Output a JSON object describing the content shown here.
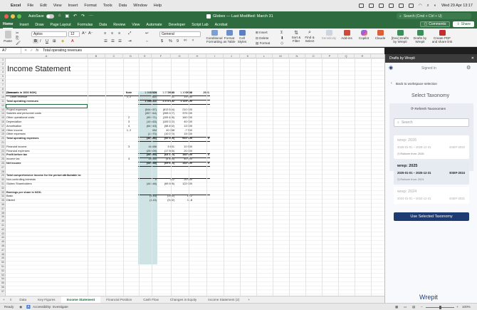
{
  "menubar": {
    "apple": "",
    "app": "Excel",
    "items": [
      "File",
      "Edit",
      "View",
      "Insert",
      "Format",
      "Tools",
      "Data",
      "Window",
      "Help"
    ],
    "datetime": "Wed 29 Apr 13:17"
  },
  "titlebar": {
    "autosave": "AutoSave",
    "doc_title": "Globex — Last Modified: March 31",
    "search_placeholder": "Search (Cmd + Ctrl + U)"
  },
  "ribbon_tabs": [
    "Home",
    "Insert",
    "Draw",
    "Page Layout",
    "Formulas",
    "Data",
    "Review",
    "View",
    "Automate",
    "Developer",
    "Script Lab",
    "Acrobat"
  ],
  "comments_label": "Comments",
  "share_label": "Share",
  "ribbon": {
    "paste": "Paste",
    "font": "Aptos",
    "font_size": "12",
    "number_format": "General",
    "insert": "Insert",
    "delete": "Delete",
    "format": "Format",
    "cond_format": "Conditional Formatting",
    "format_table": "Format as Table",
    "cell_styles": "Cell Styles",
    "sort_filter": "Sort & Filter",
    "find_select": "Find & Select",
    "sensitivity": "Sensitivity",
    "addins": "Add-ins",
    "copilot": "Copilot",
    "claude": "Claude",
    "drafts": "[Dev] Drafts by Wrepit",
    "drafts2": "Drafts by Wrepit",
    "create_pdf": "Create PDF and share link"
  },
  "formula": {
    "cell_ref": "A7",
    "fx": "fx",
    "value": "Total operating revenues"
  },
  "columns": [
    "A",
    "B",
    "C",
    "D",
    "E",
    "F",
    "G",
    "H",
    "I",
    "J",
    "K",
    "L",
    "M",
    "N",
    "O",
    "P",
    "Q",
    "R"
  ],
  "rows": [
    "1",
    "2",
    "3",
    "4",
    "5",
    "6",
    "7",
    "8",
    "9",
    "10",
    "11",
    "12",
    "13",
    "14",
    "15",
    "16",
    "17",
    "18",
    "19",
    "20",
    "21",
    "22",
    "23",
    "24",
    "25",
    "26",
    "27",
    "28",
    "29",
    "30",
    "31",
    "32",
    "33",
    "34",
    "35",
    "36",
    "37",
    "38",
    "39",
    "40",
    "41",
    "42",
    "43",
    "44",
    "45",
    "46",
    "47",
    "48",
    "49",
    "50",
    "51",
    "52",
    "53",
    "54",
    "55",
    "56",
    "57"
  ],
  "sheet": {
    "title": "Income Statement",
    "header": {
      "label": "(Amounts in 1000 NOK)",
      "note": "Note",
      "y2024": "2024",
      "y2023": "2023",
      "y2022": "2022",
      "y2021": "2021"
    },
    "lines": [
      {
        "label": "Revenue",
        "note": "",
        "a": "1 088 870",
        "b": "1 273 641",
        "c": "1 100 000",
        "d": ""
      },
      {
        "label": "Other revenue",
        "note": "1, 2",
        "a": "521",
        "b": "11",
        "c": "19 000",
        "d": ""
      },
      {
        "label": "Total operating revenues",
        "note": "",
        "a": "1 089 411",
        "b": "1 273 652",
        "c": "1 119 000",
        "d": ""
      },
      {
        "label": "",
        "note": "",
        "a": "",
        "b": "",
        "c": "",
        "d": ""
      },
      {
        "label": "Project expenses",
        "note": "",
        "a": "(544 657)",
        "b": "(813 534)",
        "c": "210 000",
        "d": ""
      },
      {
        "label": "Salaries and personnel costs",
        "note": "",
        "a": "(357 964)",
        "b": "(265 027)",
        "c": "375 000",
        "d": ""
      },
      {
        "label": "Other operational costs",
        "note": "2",
        "a": "(99 571)",
        "b": "(109 426)",
        "c": "160 000",
        "d": ""
      },
      {
        "label": "Depreciation",
        "note": "3",
        "a": "(10 663)",
        "b": "(109 222)",
        "c": "40 000",
        "d": ""
      },
      {
        "label": "Amortisation",
        "note": "4",
        "a": "(64 915)",
        "b": "(58 492)",
        "c": "13 000",
        "d": ""
      },
      {
        "label": "Other income",
        "note": "1, 2",
        "a": "494",
        "b": "40 058",
        "c": "-7 500",
        "d": ""
      },
      {
        "label": "Other expenses",
        "note": "",
        "a": "(1 970)",
        "b": "(10 070)",
        "c": "15 000",
        "d": ""
      },
      {
        "label": "Total operating expenses",
        "note": "",
        "a": "(30 486)",
        "b": "(52 205)",
        "c": "921 500",
        "d": "0"
      },
      {
        "label": "",
        "note": "",
        "a": "",
        "b": "",
        "c": "",
        "d": ""
      },
      {
        "label": "Financial income",
        "note": "3",
        "a": "16 456",
        "b": "5 601",
        "c": "10 500",
        "d": ""
      },
      {
        "label": "Financial expenses",
        "note": "",
        "a": "(25 509)",
        "b": "(17 565)",
        "c": "20 000",
        "d": ""
      },
      {
        "label": "Profit before tax",
        "note": "",
        "a": "(59 550)",
        "b": "(64 170)",
        "c": "182 000",
        "d": "0"
      },
      {
        "label": "Income tax",
        "note": "3",
        "a": "15 000",
        "b": "(4 445)",
        "c": "40 000",
        "d": ""
      },
      {
        "label": "Net income",
        "note": "",
        "a": "(44 548)",
        "b": "(69 614)",
        "c": "142 000",
        "d": "0"
      },
      {
        "label": "",
        "note": "",
        "a": "",
        "b": "",
        "c": "",
        "d": ""
      },
      {
        "label": "",
        "note": "",
        "a": "",
        "b": "",
        "c": "",
        "d": ""
      },
      {
        "label": "Total comprehensive income for the period attributable to:",
        "note": "",
        "a": "",
        "b": "",
        "c": "",
        "d": ""
      },
      {
        "label": "Non-controlling interests",
        "note": "",
        "a": "0",
        "b": "312",
        "c": "20 000",
        "d": ""
      },
      {
        "label": "Globex Shareholders",
        "note": "",
        "a": "(44 548)",
        "b": "(69 926)",
        "c": "122 000",
        "d": ""
      },
      {
        "label": "",
        "note": "",
        "a": "",
        "b": "",
        "c": "",
        "d": ""
      },
      {
        "label": "Earnings per share in NOK:",
        "note": "",
        "a": "",
        "b": "",
        "c": "",
        "d": ""
      },
      {
        "label": "Basic",
        "note": "",
        "a": "(1,43)",
        "b": "(3,02)",
        "c": "12,2",
        "d": ""
      },
      {
        "label": "Diluted",
        "note": "",
        "a": "(1,43)",
        "b": "(3,02)",
        "c": "11,8",
        "d": ""
      }
    ]
  },
  "sheet_tabs": [
    "Data",
    "Key Figures",
    "Income Statement",
    "Financial Position",
    "Cash Flow",
    "Changes in Equity",
    "Income Statement (2)"
  ],
  "active_sheet": "Income Statement",
  "status": {
    "ready": "Ready",
    "accessibility": "Accessibility: Investigate",
    "zoom": "100%"
  },
  "panel": {
    "title": "Drafts by Wrepit",
    "signed_in": "Signed in",
    "back": "Back to workspace selection",
    "heading": "Select Taxonomy",
    "refresh": "Refresh Taxonomies",
    "search_placeholder": "Search",
    "taxonomies": [
      {
        "name": "wrep: 2026",
        "range": "2026-01-01 – 2026-12-31",
        "code": "ESEF-2022",
        "note": "Rollover from: 2026"
      },
      {
        "name": "wrep: 2025",
        "range": "2025-01-01 – 2025-12-31",
        "code": "ESEF-2024",
        "note": "Rollover from: 2024"
      },
      {
        "name": "wrep: 2024",
        "range": "2024-01-01 – 2024-12-31",
        "code": "ESEF-2021",
        "note": ""
      }
    ],
    "use_button": "Use Selected Taxonomy",
    "brand": "Wrepit"
  },
  "colors": {
    "excel_green": "#2e6b3f",
    "highlight": "#cfe3e4",
    "panel_button": "#1f3b73"
  }
}
